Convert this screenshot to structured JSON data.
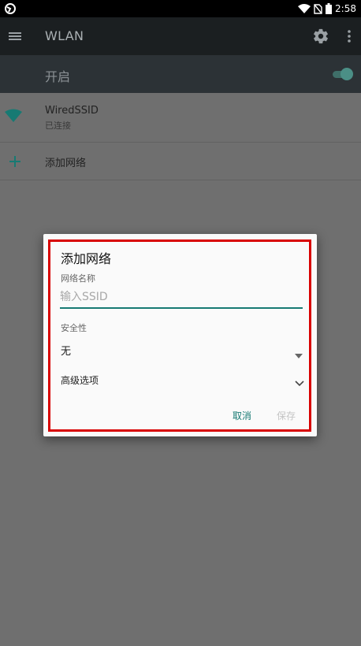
{
  "status_bar": {
    "time": "2:58",
    "icons": [
      "app-notification-icon",
      "wifi-signal-icon",
      "no-sim-icon",
      "battery-icon"
    ]
  },
  "toolbar": {
    "title": "WLAN",
    "icons": [
      "menu-icon",
      "gear-icon",
      "more-vert-icon"
    ]
  },
  "master_switch": {
    "label": "开启",
    "state": "on",
    "accent_color": "#4b8f86"
  },
  "list": {
    "connected_network": {
      "ssid": "WiredSSID",
      "status": "已连接",
      "icon": "wifi-icon"
    },
    "add_network_label": "添加网络",
    "add_icon": "plus-icon"
  },
  "dialog": {
    "title": "添加网络",
    "network_name_label": "网络名称",
    "ssid_value": "",
    "ssid_placeholder": "输入SSID",
    "security_label": "安全性",
    "security_value": "无",
    "advanced_label": "高级选项",
    "cancel_label": "取消",
    "save_label": "保存",
    "accent_color": "#177a73",
    "highlight_color": "#d80000"
  }
}
